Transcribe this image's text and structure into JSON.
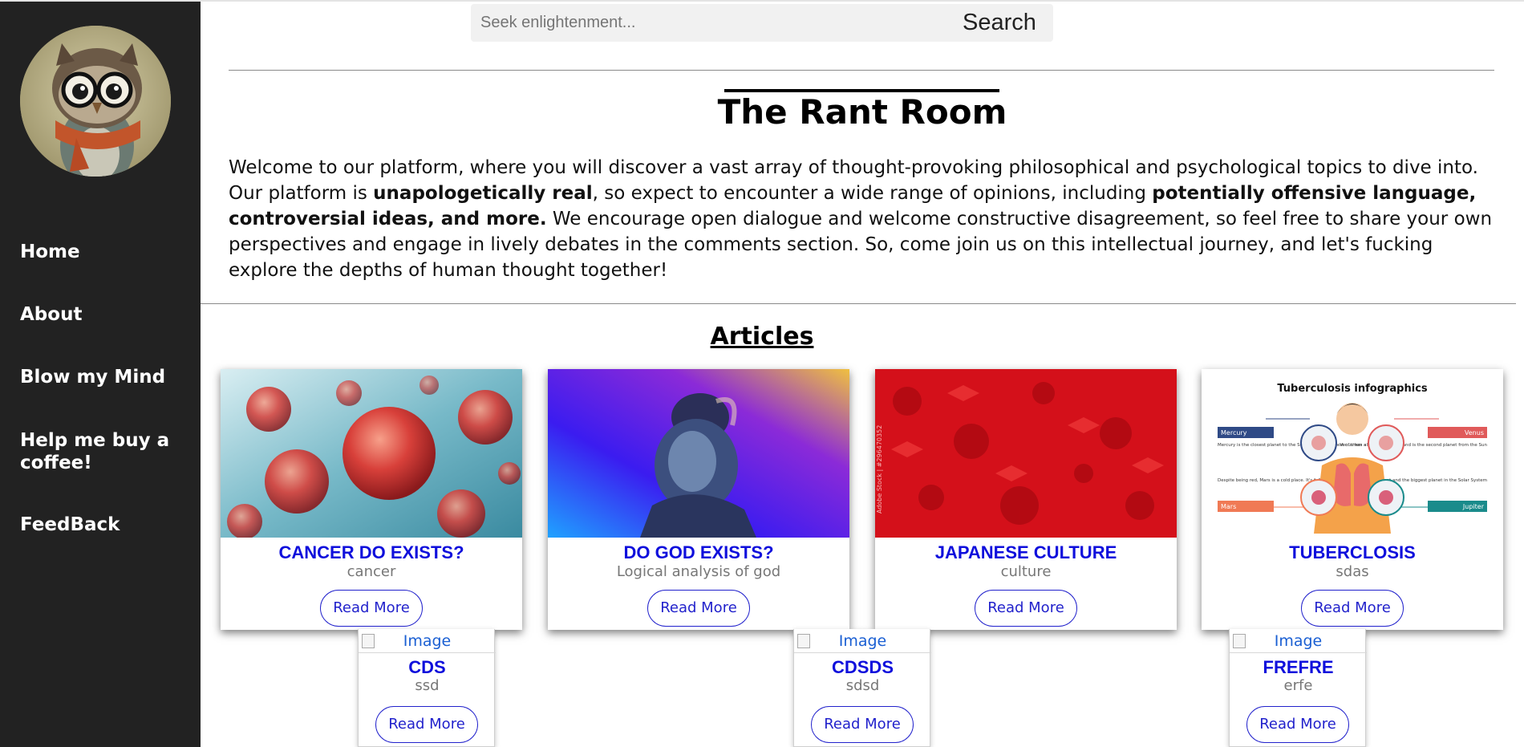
{
  "search": {
    "placeholder": "Seek enlightenment...",
    "button_label": "Search"
  },
  "sidebar": {
    "items": [
      {
        "label": "Home"
      },
      {
        "label": "About"
      },
      {
        "label": "Blow my Mind"
      },
      {
        "label": "Help me buy a coffee!"
      },
      {
        "label": "FeedBack"
      }
    ]
  },
  "page": {
    "title": "The Rant Room",
    "intro": {
      "p1": "Welcome to our platform, where you will discover a vast array of thought-provoking philosophical and psychological topics to dive into. Our platform is ",
      "b1": "unapologetically real",
      "p2": ", so expect to encounter a wide range of opinions, including ",
      "b2": "potentially offensive language, controversial ideas, and more.",
      "p3": " We encourage open dialogue and welcome constructive disagreement, so feel free to share your own perspectives and engage in lively debates in the comments section. So, come join us on this intellectual journey, and let's fucking explore the depths of human thought together!"
    }
  },
  "articles": {
    "heading": "Articles",
    "read_more_label": "Read More",
    "cards": [
      {
        "title": "CANCER DO EXISTS?",
        "subtitle": "cancer"
      },
      {
        "title": "DO GOD EXISTS?",
        "subtitle": "Logical analysis of god"
      },
      {
        "title": "JAPANESE CULTURE",
        "subtitle": "culture",
        "image_watermark": "Adobe Stock | #296470352"
      },
      {
        "title": "TUBERCLOSIS",
        "subtitle": "sdas",
        "infographic": {
          "title": "Tuberculosis infographics",
          "mercury_label": "Mercury",
          "mercury_text": "Mercury is the closest planet to the Sun and the smallest of them all",
          "mars_label": "Mars",
          "mars_text": "Despite being red, Mars is a cold place. It's full of iron oxide dust",
          "venus_label": "Venus",
          "venus_text": "Venus has a beautiful name and is the second planet from the Sun",
          "jupiter_label": "Jupiter",
          "jupiter_text": "Jupiter is a gas giant and the biggest planet in the Solar System"
        }
      }
    ],
    "small_cards": [
      {
        "image_alt": "Image",
        "title": "CDS",
        "subtitle": "ssd"
      },
      {
        "image_alt": "Image",
        "title": "CDSDS",
        "subtitle": "sdsd"
      },
      {
        "image_alt": "Image",
        "title": "FREFRE",
        "subtitle": "erfe"
      }
    ]
  },
  "colors": {
    "sidebar_bg": "#222222",
    "link_blue": "#0f0fdc",
    "button_border": "#2222cc",
    "muted_text": "#777777"
  }
}
